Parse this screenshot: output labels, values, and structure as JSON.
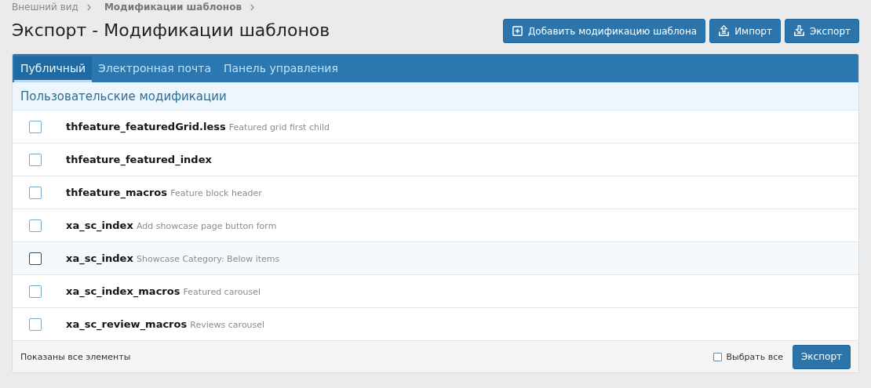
{
  "breadcrumb": [
    {
      "label": "Внешний вид",
      "current": false
    },
    {
      "label": "Модификации шаблонов",
      "current": true
    }
  ],
  "title": "Экспорт - Модификации шаблонов",
  "actions": [
    {
      "label": "Добавить модификацию шаблона",
      "kind": "add"
    },
    {
      "label": "Импорт",
      "kind": "upload"
    },
    {
      "label": "Экспорт",
      "kind": "download"
    }
  ],
  "tabs": [
    {
      "label": "Публичный",
      "selected": true
    },
    {
      "label": "Электронная почта",
      "selected": false
    },
    {
      "label": "Панель управления",
      "selected": false
    }
  ],
  "section_title": "Пользовательские модификации",
  "rows": [
    {
      "name": "thfeature_featuredGrid.less",
      "description": "Featured grid first child",
      "checked": false,
      "highlighted": false
    },
    {
      "name": "thfeature_featured_index",
      "checked": false,
      "highlighted": false
    },
    {
      "name": "thfeature_macros",
      "description": "Feature block header",
      "checked": false,
      "highlighted": false
    },
    {
      "name": "xa_sc_index",
      "description": "Add showcase page button form",
      "checked": false,
      "highlighted": false
    },
    {
      "name": "xa_sc_index",
      "description": "Showcase Category: Below items",
      "checked": false,
      "highlighted": true
    },
    {
      "name": "xa_sc_index_macros",
      "description": "Featured carousel",
      "checked": false,
      "highlighted": false
    },
    {
      "name": "xa_sc_review_macros",
      "description": "Reviews carousel",
      "checked": false,
      "highlighted": false
    }
  ],
  "footer": {
    "status": "Показаны все элементы",
    "select_all": {
      "label": "Выбрать все",
      "checked": false
    },
    "submit": "Экспорт"
  }
}
